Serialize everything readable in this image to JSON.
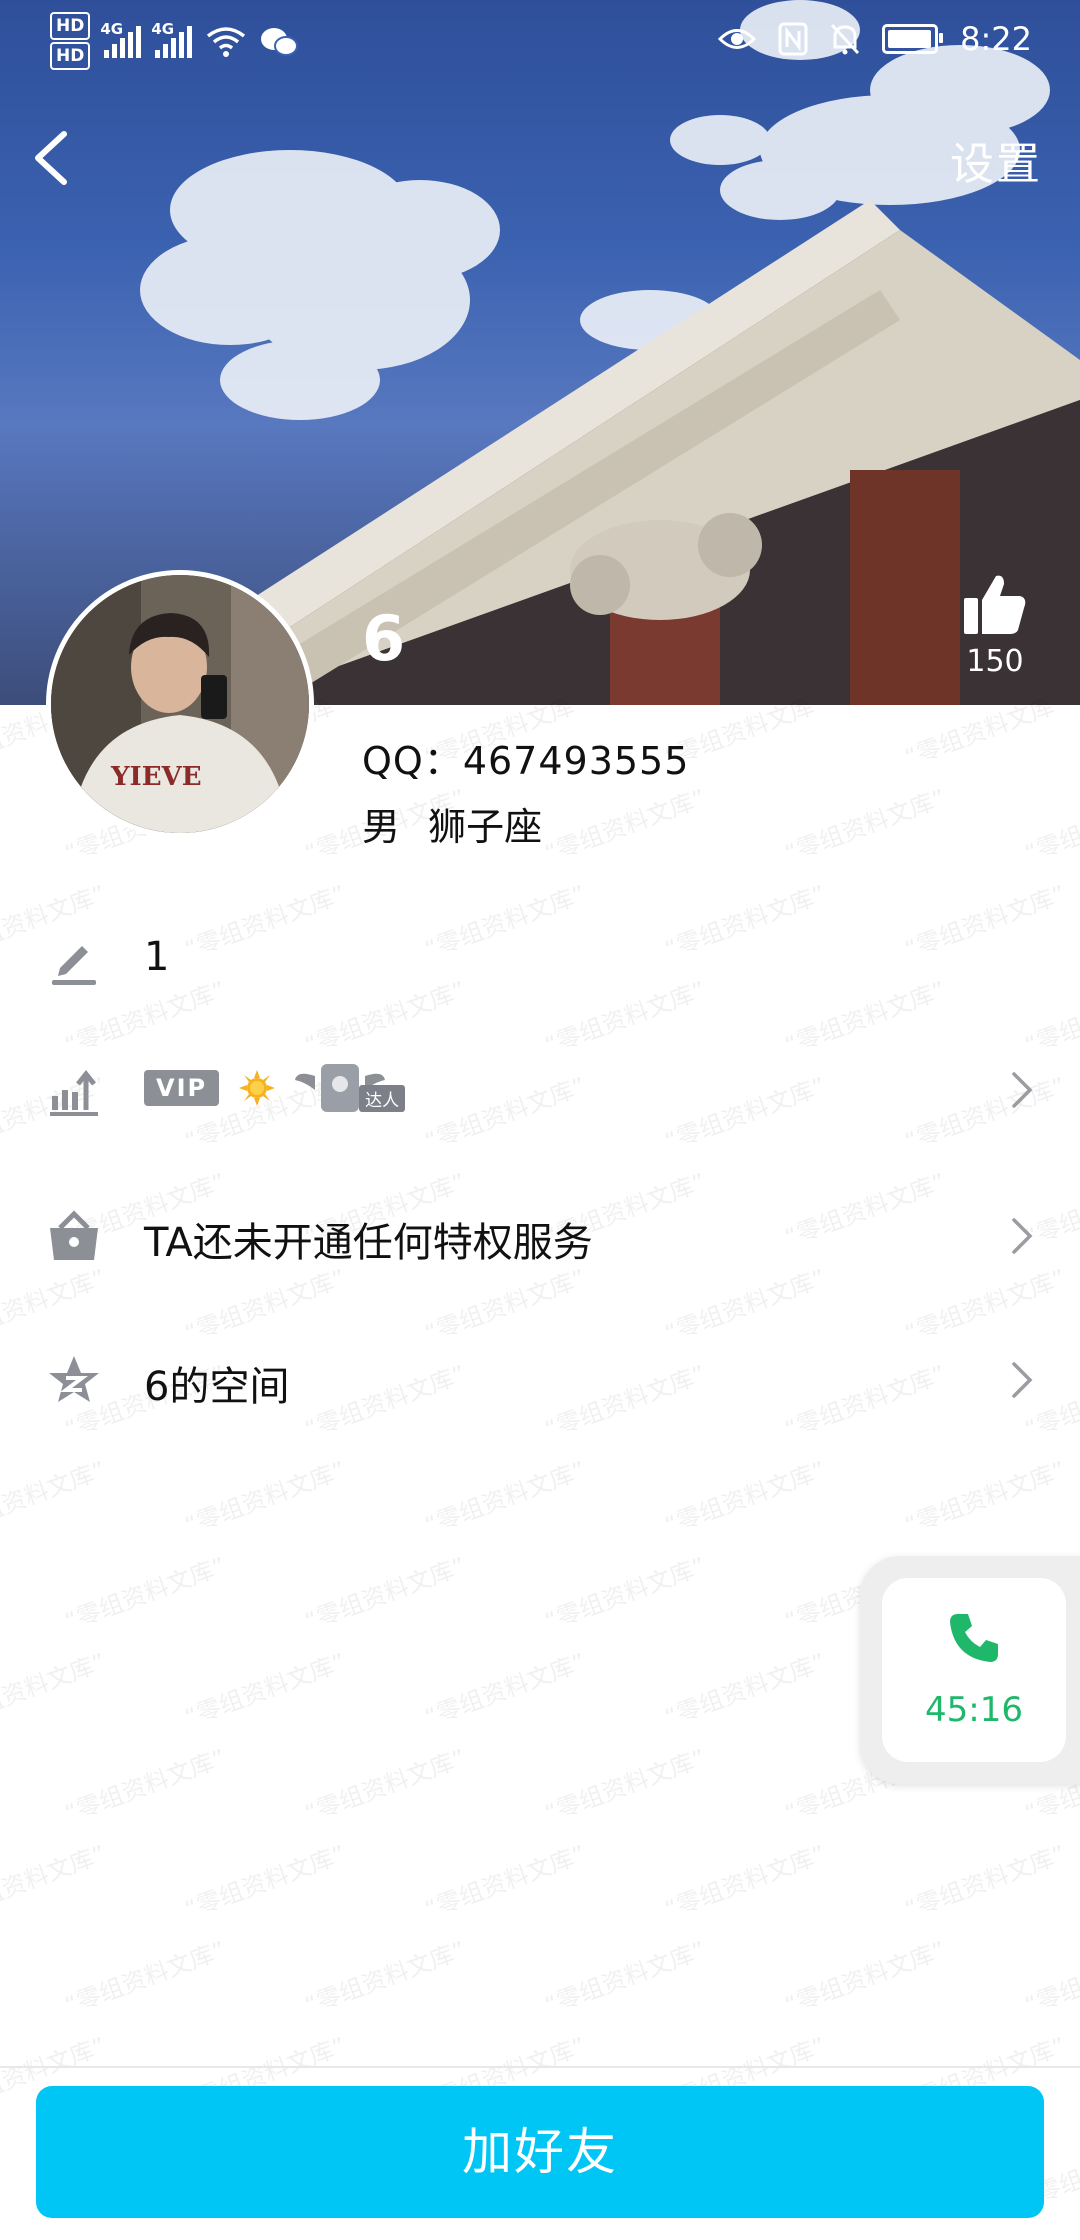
{
  "status_bar": {
    "hd1": "HD",
    "hd2": "HD",
    "net1": "4G",
    "net2": "4G",
    "time": "8:22"
  },
  "header": {
    "back_icon": "chevron-left-icon",
    "settings_label": "设置",
    "nickname": "6",
    "like_count": "150"
  },
  "profile": {
    "qq_label": "QQ：467493555",
    "gender": "男",
    "constellation": "狮子座"
  },
  "rows": {
    "signature": {
      "icon": "pencil-icon",
      "text": "1"
    },
    "levels": {
      "icon": "growth-chart-icon",
      "vip_label": "VIP",
      "daren_label": "达人"
    },
    "privilege": {
      "icon": "shop-bag-icon",
      "text": "TA还未开通任何特权服务"
    },
    "space": {
      "icon": "qzone-star-icon",
      "text": "6的空间"
    }
  },
  "call": {
    "icon": "phone-icon",
    "duration": "45:16"
  },
  "actions": {
    "add_friend_label": "加好友"
  },
  "watermark_text": "零组资料文库",
  "colors": {
    "primary_button": "#00c6f6",
    "call_green": "#1fb86a",
    "icon_gray": "#8c8f96"
  }
}
